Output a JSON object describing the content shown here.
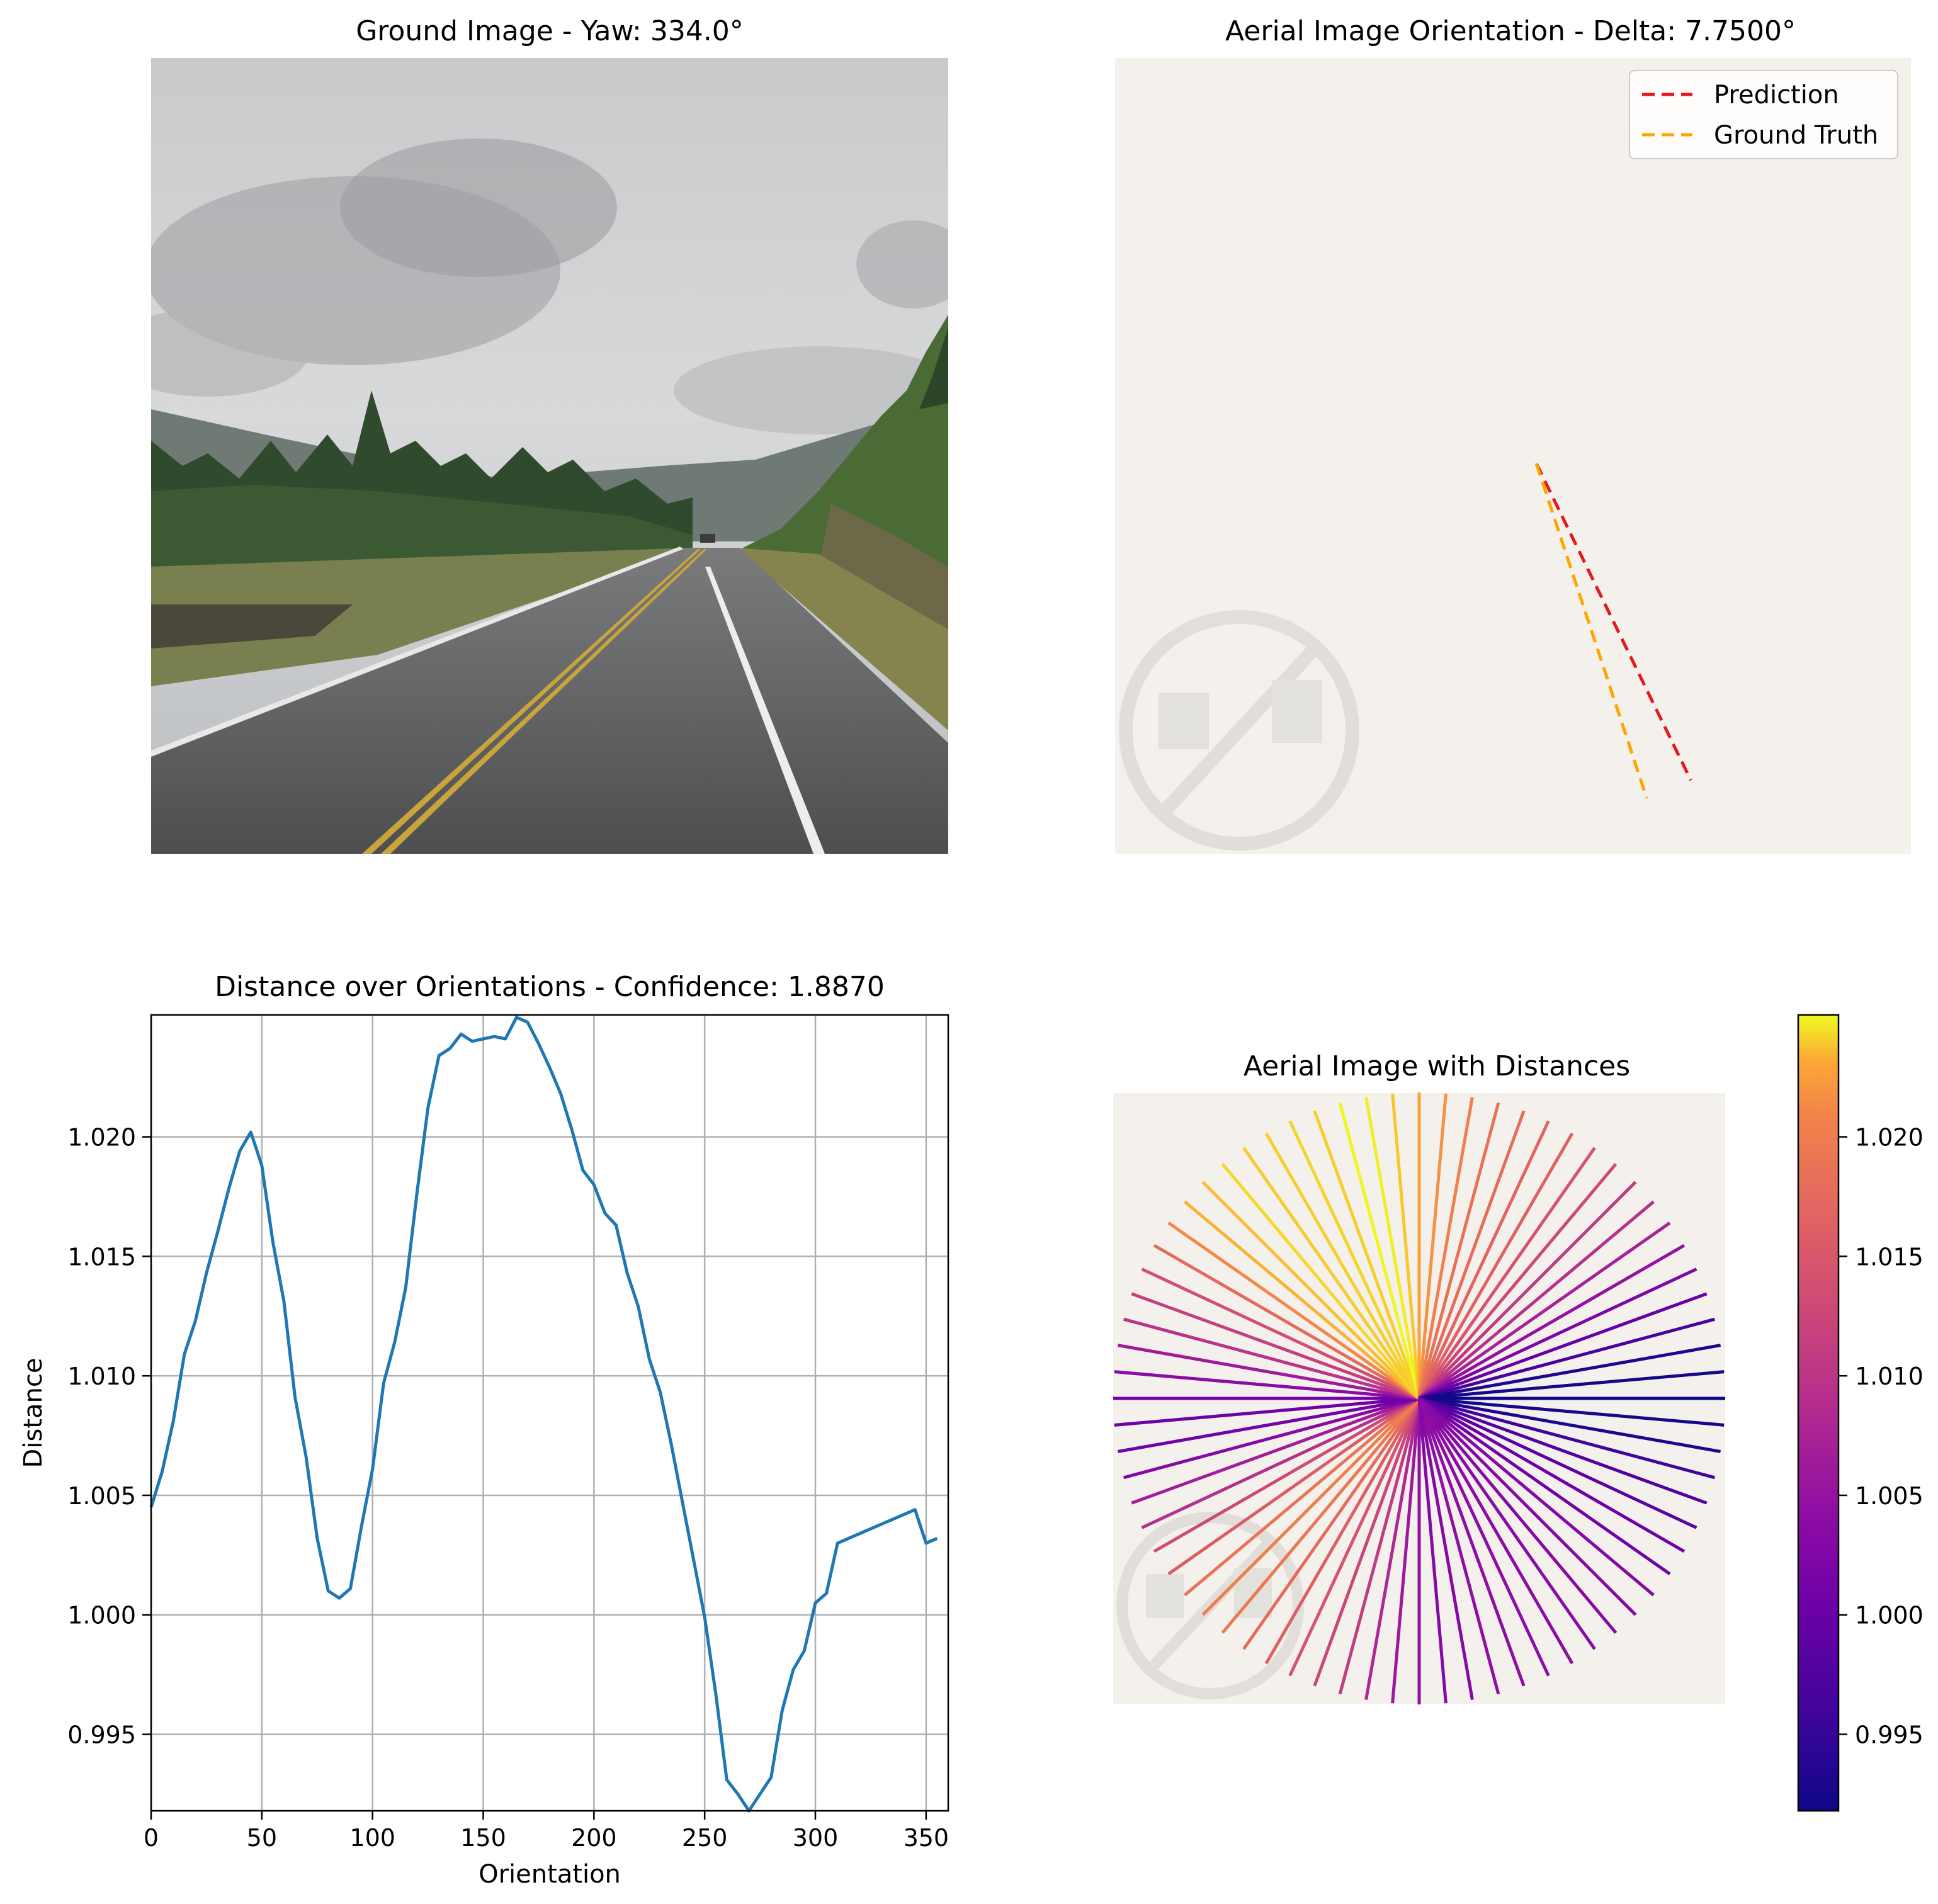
{
  "colors": {
    "line": "#1f77b4",
    "prediction": "#e41a1c",
    "ground_truth": "#ffa500",
    "grid": "#b0b0b0",
    "aerial_bg": "#f4f1ec"
  },
  "ground_panel": {
    "title": "Ground Image - Yaw: 334.0°"
  },
  "orientation_panel": {
    "title": "Aerial Image Orientation - Delta: 7.7500°",
    "legend": [
      "Prediction",
      "Ground Truth"
    ],
    "prediction_angle_deg": 334.0,
    "ground_truth_angle_deg": 341.75
  },
  "chart_data": [
    {
      "type": "line",
      "title": "Distance over Orientations - Confidence: 1.8870",
      "xlabel": "Orientation",
      "ylabel": "Distance",
      "xlim": [
        0,
        360
      ],
      "ylim": [
        0.9918,
        1.0251
      ],
      "xticks": [
        0,
        50,
        100,
        150,
        200,
        250,
        300,
        350
      ],
      "yticks": [
        0.995,
        1.0,
        1.005,
        1.01,
        1.015,
        1.02
      ],
      "ytick_labels": [
        "0.995",
        "1.000",
        "1.005",
        "1.010",
        "1.015",
        "1.020"
      ],
      "grid": true,
      "x": [
        0,
        5,
        10,
        15,
        20,
        25,
        30,
        35,
        40,
        45,
        50,
        55,
        60,
        65,
        70,
        75,
        80,
        85,
        90,
        95,
        100,
        105,
        110,
        115,
        120,
        125,
        130,
        135,
        140,
        145,
        150,
        155,
        160,
        165,
        170,
        175,
        180,
        185,
        190,
        195,
        200,
        205,
        210,
        215,
        220,
        225,
        230,
        235,
        240,
        245,
        250,
        255,
        260,
        265,
        270,
        275,
        280,
        285,
        290,
        295,
        300,
        305,
        310,
        315,
        320,
        325,
        330,
        335,
        340,
        345,
        350,
        355
      ],
      "y": [
        1.0045,
        1.006,
        1.0081,
        1.0109,
        1.0123,
        1.0143,
        1.016,
        1.0178,
        1.0194,
        1.0202,
        1.0188,
        1.0156,
        1.0131,
        1.0091,
        1.0066,
        1.0032,
        1.001,
        1.0007,
        1.0011,
        1.0037,
        1.0061,
        1.0097,
        1.0114,
        1.0137,
        1.0176,
        1.0212,
        1.0234,
        1.0237,
        1.0243,
        1.024,
        1.0241,
        1.0242,
        1.0241,
        1.025,
        1.0248,
        1.0239,
        1.0229,
        1.0218,
        1.0203,
        1.0186,
        1.018,
        1.0168,
        1.0163,
        1.0143,
        1.0129,
        1.0107,
        1.0093,
        1.0071,
        1.0047,
        1.0023,
        0.9999,
        0.9967,
        0.9931,
        0.9925,
        0.9918,
        0.9925,
        0.9932,
        0.996,
        0.9977,
        0.9985,
        1.0005,
        1.0009,
        1.003,
        1.0032,
        1.0034,
        1.0036,
        1.0038,
        1.004,
        1.0042,
        1.0044,
        1.003,
        1.0032
      ]
    },
    {
      "type": "radial",
      "title": "Aerial Image with Distances",
      "angle_step_deg": 5,
      "colorbar": {
        "cmap": "plasma",
        "range": [
          0.9918,
          1.0251
        ],
        "ticks": [
          0.995,
          1.0,
          1.005,
          1.01,
          1.015,
          1.02
        ],
        "tick_labels": [
          "0.995",
          "1.000",
          "1.005",
          "1.010",
          "1.015",
          "1.020"
        ]
      }
    }
  ]
}
